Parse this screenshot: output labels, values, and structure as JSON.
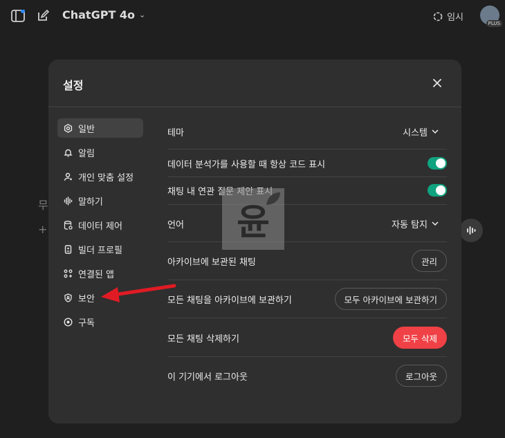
{
  "header": {
    "model_name": "ChatGPT 4o",
    "temporary_label": "임시",
    "avatar_badge": "PLUS"
  },
  "settings": {
    "title": "설정",
    "nav": [
      {
        "label": "일반",
        "icon": "gear-icon",
        "active": true
      },
      {
        "label": "알림",
        "icon": "bell-icon"
      },
      {
        "label": "개인 맞춤 설정",
        "icon": "person-sparkle-icon"
      },
      {
        "label": "말하기",
        "icon": "waveform-icon"
      },
      {
        "label": "데이터 제어",
        "icon": "database-icon"
      },
      {
        "label": "빌더 프로필",
        "icon": "id-card-icon"
      },
      {
        "label": "연결된 앱",
        "icon": "apps-grid-icon"
      },
      {
        "label": "보안",
        "icon": "shield-icon"
      },
      {
        "label": "구독",
        "icon": "subscription-icon"
      }
    ],
    "general": {
      "theme_label": "테마",
      "theme_value": "시스템",
      "code_label": "데이터 분석가를 사용할 때 항상 코드 표시",
      "code_on": true,
      "suggest_label": "채팅 내 연관 질문 제안 표시",
      "suggest_on": true,
      "language_label": "언어",
      "language_value": "자동 탐지",
      "archived_label": "아카이브에 보관된 채팅",
      "archived_button": "관리",
      "archive_all_label": "모든 채팅을 아카이브에 보관하기",
      "archive_all_button": "모두 아카이브에 보관하기",
      "delete_all_label": "모든 채팅 삭제하기",
      "delete_all_button": "모두 삭제",
      "logout_label": "이 기기에서 로그아웃",
      "logout_button": "로그아웃"
    }
  },
  "watermark_text": "윤",
  "colors": {
    "toggle_on": "#10a37f",
    "danger": "#ef4146",
    "annotation_arrow": "#e01b24"
  }
}
